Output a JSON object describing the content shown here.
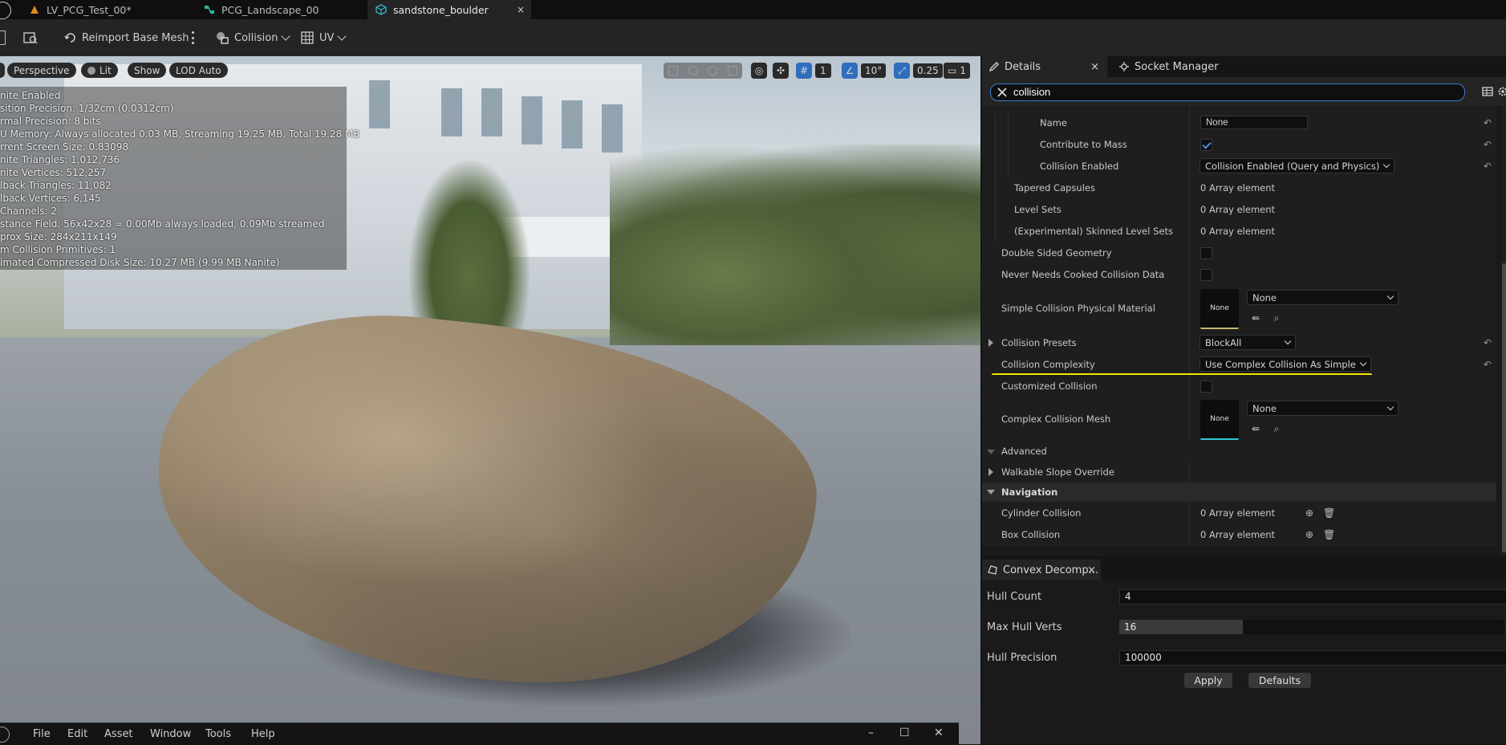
{
  "tabs": [
    {
      "label": "LV_PCG_Test_00*",
      "icon": "level-icon"
    },
    {
      "label": "PCG_Landscape_00",
      "icon": "pcg-graph-icon"
    },
    {
      "label": "sandstone_boulder",
      "icon": "static-mesh-icon",
      "close": "×"
    }
  ],
  "toolbar": {
    "reimport": "Reimport Base Mesh",
    "collision": "Collision",
    "uv": "UV"
  },
  "viewport": {
    "perspective": "Perspective",
    "lit": "Lit",
    "show": "Show",
    "lod": "LOD Auto",
    "grid_snap": "1",
    "angle_snap": "10°",
    "scale_snap": "0.25",
    "camera_speed": "1",
    "stats": [
      "nite Enabled",
      "sition Precision: 1/32cm (0.0312cm)",
      "rmal Precision: 8 bits",
      "U Memory: Always allocated 0.03 MB, Streaming 19.25 MB, Total 19.28 MB",
      "rrent Screen Size: 0.83098",
      "nite Triangles: 1,012,736",
      "nite Vertices: 512,257",
      "lback Triangles: 11,082",
      "lback Vertices: 6,145",
      "Channels: 2",
      "stance Field: 56x42x28 = 0.00Mb always loaded, 0.09Mb streamed",
      "prox Size: 284x211x149",
      "m Collision Primitives: 1",
      "imated Compressed Disk Size: 10.27 MB (9.99 MB Nanite)"
    ]
  },
  "menu": {
    "items": [
      "File",
      "Edit",
      "Asset",
      "Window",
      "Tools",
      "Help"
    ],
    "minimize": "–",
    "maximize": "☐",
    "close": "✕"
  },
  "details": {
    "tab_label": "Details",
    "tab_close": "×",
    "socket_tab": "Socket Manager",
    "search_value": "collision",
    "rows": {
      "name_label": "Name",
      "name_value": "None",
      "contribute_label": "Contribute to Mass",
      "collision_enabled_label": "Collision Enabled",
      "collision_enabled_value": "Collision Enabled (Query and Physics)",
      "tapered_label": "Tapered Capsules",
      "tapered_value": "0 Array element",
      "levelsets_label": "Level Sets",
      "levelsets_value": "0 Array element",
      "skinned_label": "(Experimental) Skinned Level Sets",
      "skinned_value": "0 Array element",
      "double_sided_label": "Double Sided Geometry",
      "never_cooked_label": "Never Needs Cooked Collision Data",
      "simple_phys_label": "Simple Collision Physical Material",
      "simple_phys_thumb": "None",
      "simple_phys_value": "None",
      "presets_label": "Collision Presets",
      "presets_value": "BlockAll",
      "complexity_label": "Collision Complexity",
      "complexity_value": "Use Complex Collision As Simple",
      "customized_label": "Customized Collision",
      "complex_mesh_label": "Complex Collision Mesh",
      "complex_mesh_thumb": "None",
      "complex_mesh_value": "None",
      "advanced_label": "Advanced",
      "walkable_label": "Walkable Slope Override",
      "navigation_label": "Navigation",
      "cylinder_label": "Cylinder Collision",
      "cylinder_value": "0 Array element",
      "box_label": "Box Collision",
      "box_value": "0 Array element"
    },
    "highlight_color": "#f2e600"
  },
  "convex": {
    "tab_label": "Convex Decomp...",
    "tab_close": "×",
    "hull_count_label": "Hull Count",
    "hull_count_value": "4",
    "max_hull_verts_label": "Max Hull Verts",
    "max_hull_verts_value": "16",
    "max_hull_verts_fill": 0.32,
    "hull_precision_label": "Hull Precision",
    "hull_precision_value": "100000",
    "apply": "Apply",
    "defaults": "Defaults"
  }
}
